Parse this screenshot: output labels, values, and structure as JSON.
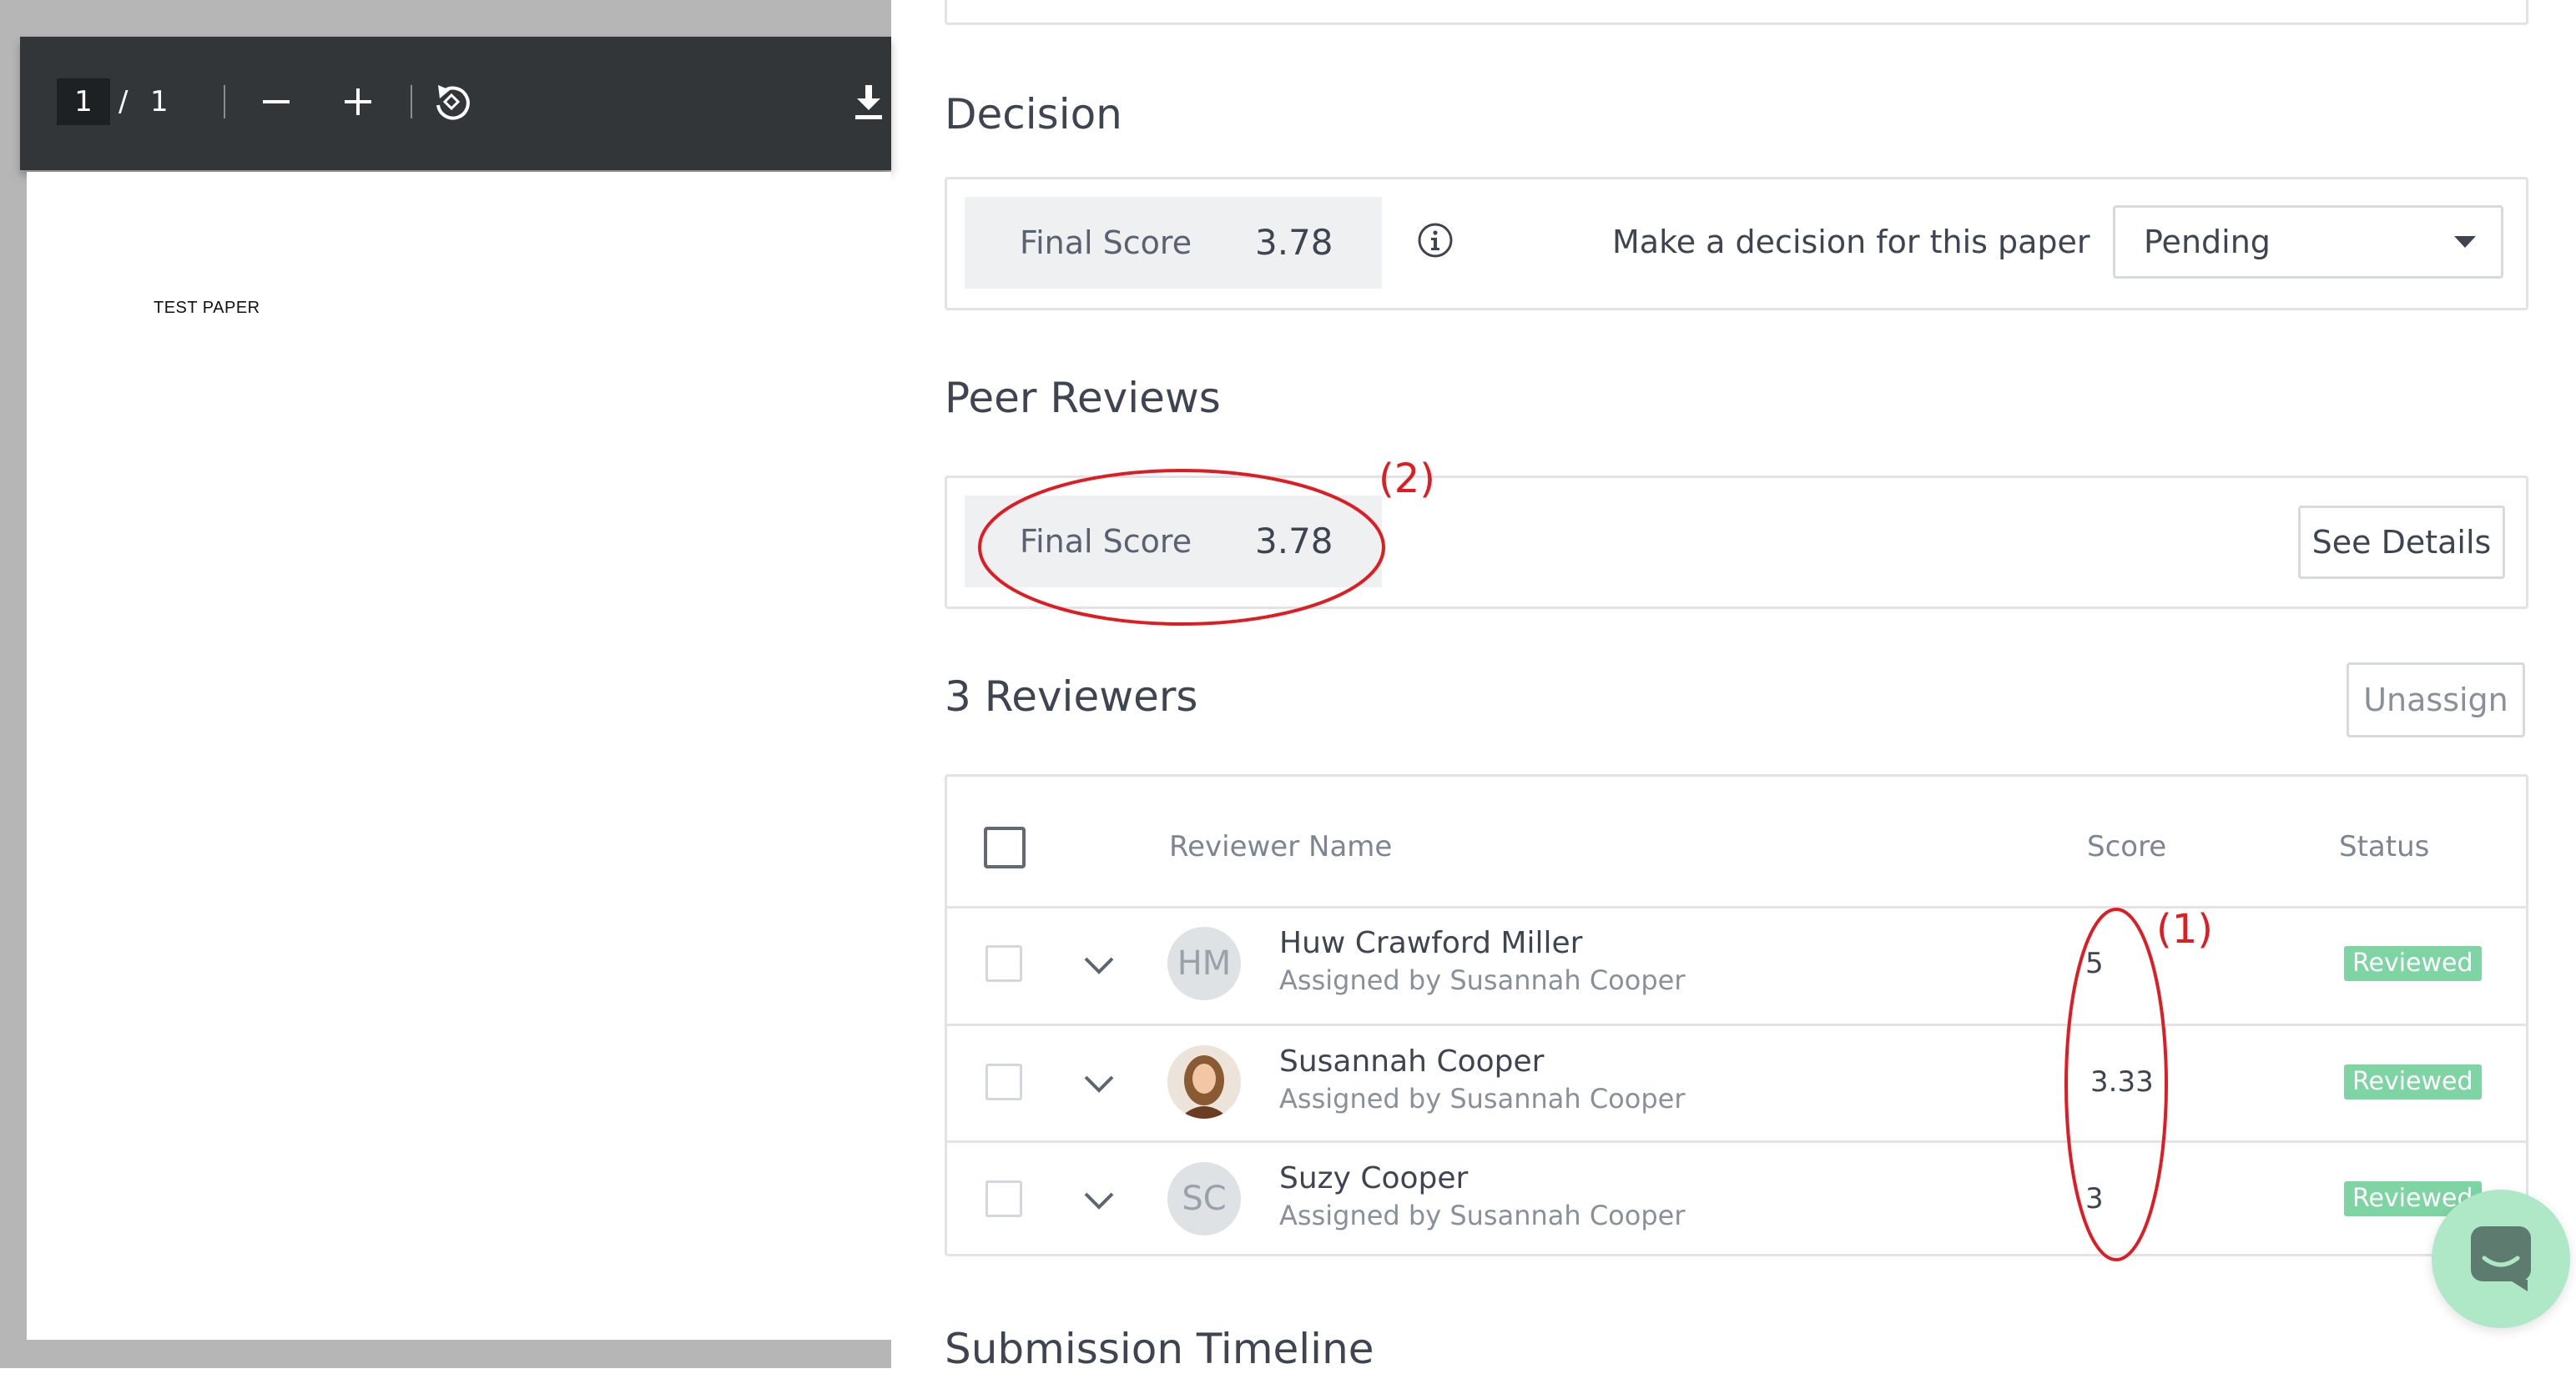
{
  "pdf_viewer": {
    "current_page": "1",
    "page_separator": "/",
    "total_pages": "1",
    "document_text": "TEST PAPER"
  },
  "decision": {
    "heading": "Decision",
    "score_label": "Final Score",
    "score_value": "3.78",
    "prompt": "Make a decision for this paper",
    "selected": "Pending"
  },
  "peer_reviews": {
    "heading": "Peer Reviews",
    "score_label": "Final Score",
    "score_value": "3.78",
    "details_button": "See Details"
  },
  "reviewers": {
    "heading": "3 Reviewers",
    "unassign_button": "Unassign",
    "columns": {
      "name": "Reviewer Name",
      "score": "Score",
      "status": "Status"
    },
    "rows": [
      {
        "initials": "HM",
        "name": "Huw Crawford Miller",
        "assigned_by": "Assigned by Susannah Cooper",
        "score": "5",
        "status": "Reviewed",
        "avatar_type": "initials"
      },
      {
        "initials": "",
        "name": "Susannah Cooper",
        "assigned_by": "Assigned by Susannah Cooper",
        "score": "3.33",
        "status": "Reviewed",
        "avatar_type": "photo"
      },
      {
        "initials": "SC",
        "name": "Suzy Cooper",
        "assigned_by": "Assigned by Susannah Cooper",
        "score": "3",
        "status": "Reviewed",
        "avatar_type": "initials"
      }
    ]
  },
  "timeline": {
    "heading": "Submission Timeline"
  },
  "annotations": {
    "label_1": "(1)",
    "label_2": "(2)",
    "color": "#e01b22"
  },
  "colors": {
    "badge_green": "#7fd4a3",
    "toolbar_dark": "#323639",
    "chat_fab": "#aee8c6"
  },
  "icons": [
    "zoom-out-icon",
    "zoom-in-icon",
    "rotate-icon",
    "download-icon",
    "info-icon",
    "chevron-down-icon",
    "chat-icon"
  ]
}
